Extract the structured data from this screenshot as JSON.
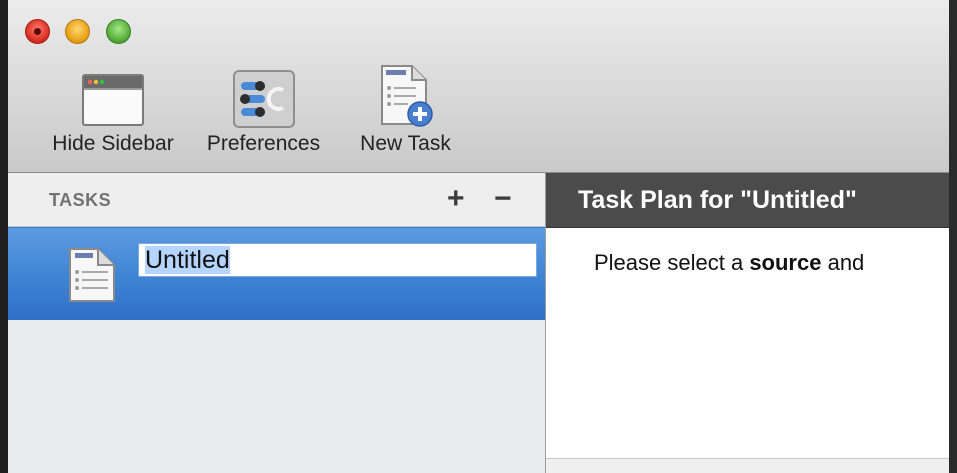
{
  "toolbar": {
    "hide_sidebar_label": "Hide Sidebar",
    "preferences_label": "Preferences",
    "new_task_label": "New Task"
  },
  "sidebar": {
    "title": "TASKS",
    "add_symbol": "+",
    "remove_symbol": "−",
    "items": [
      {
        "label": "Untitled",
        "icon": "document-icon",
        "selected": true,
        "editing": true
      }
    ]
  },
  "main": {
    "title": "Task Plan for \"Untitled\"",
    "message_prefix": "Please select a ",
    "message_bold": "source",
    "message_suffix": " and "
  },
  "colors": {
    "selection": "#3f83d4",
    "header_dark": "#4b4b4b",
    "close": "#d42a1c",
    "minimize": "#e69b0f",
    "maximize": "#4da632"
  }
}
